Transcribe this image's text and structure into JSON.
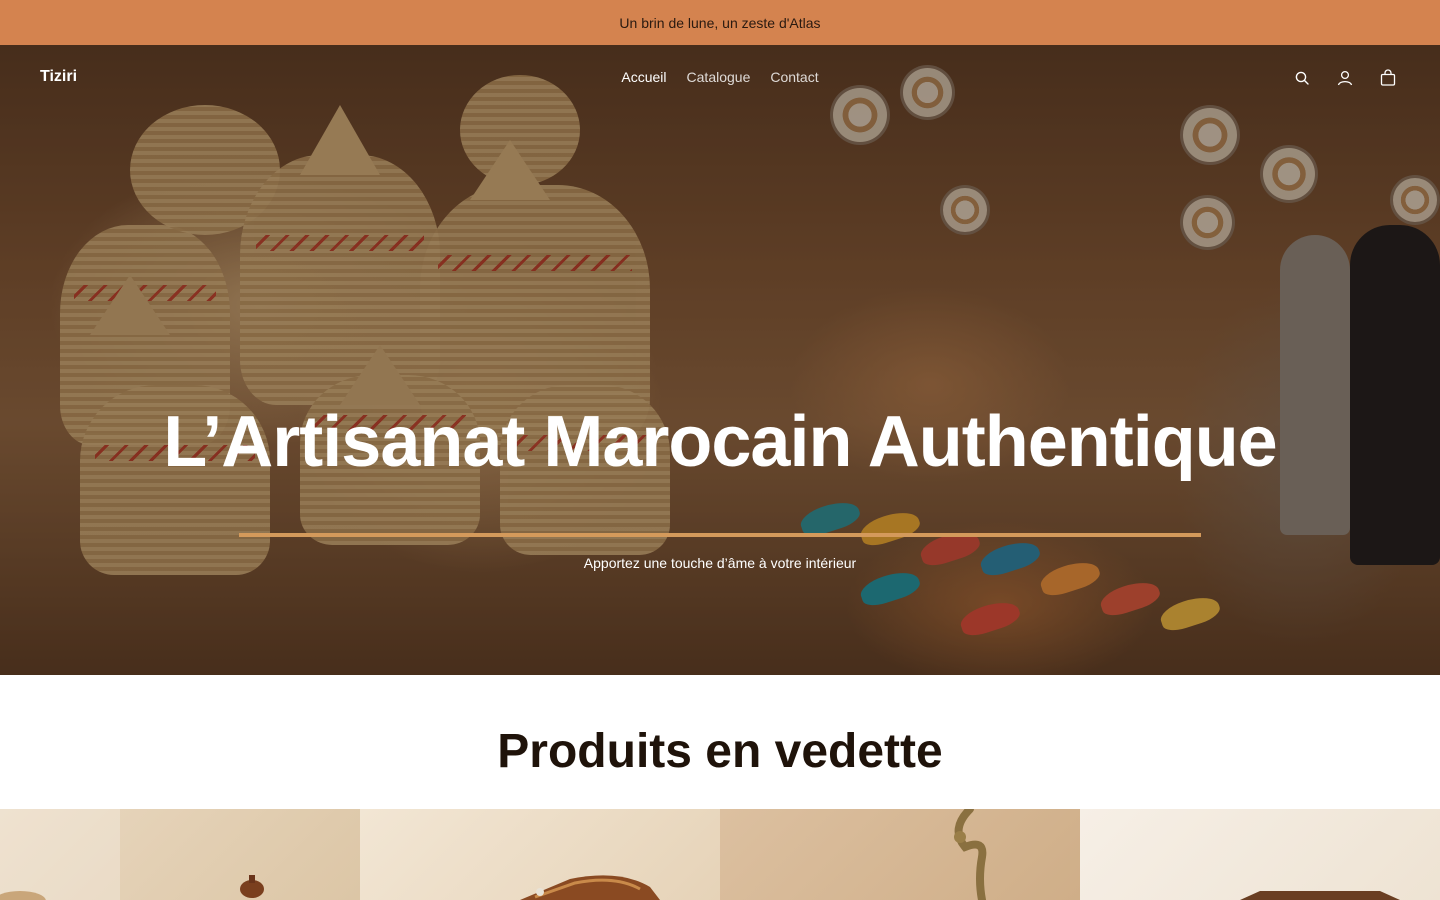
{
  "announcement": {
    "text": "Un brin de lune, un zeste d'Atlas"
  },
  "header": {
    "brand": "Tiziri",
    "nav": [
      {
        "label": "Accueil",
        "active": true
      },
      {
        "label": "Catalogue",
        "active": false
      },
      {
        "label": "Contact",
        "active": false
      }
    ],
    "icons": [
      "search-icon",
      "account-icon",
      "cart-icon"
    ]
  },
  "hero": {
    "title": "L’Artisanat Marocain Authentique",
    "subtitle": "Apportez une touche d’âme à votre intérieur"
  },
  "featured": {
    "title": "Produits en vedette"
  },
  "colors": {
    "announcement_bg": "#d4834f",
    "accent_rule": "#d49a5b",
    "text_dark": "#1f130a"
  }
}
